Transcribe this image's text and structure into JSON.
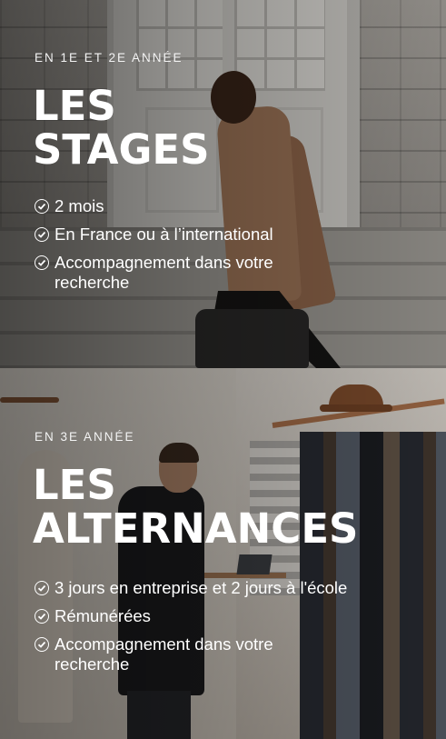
{
  "stages": {
    "eyebrow": "EN 1E ET 2E ANNÉE",
    "title_line1": "LES",
    "title_line2": "STAGES",
    "features": [
      " 2 mois",
      "En France ou à l’international",
      "Accompagnement dans votre recherche"
    ]
  },
  "alternances": {
    "eyebrow": "EN 3E ANNÉE",
    "title_line1": "LES",
    "title_line2": "ALTERNANCES",
    "features": [
      "3 jours en entreprise et 2 jours à l'école",
      "Rémunérées",
      "Accompagnement dans votre recherche"
    ]
  },
  "icons": {
    "feature_bullet": "check-circle-icon"
  }
}
